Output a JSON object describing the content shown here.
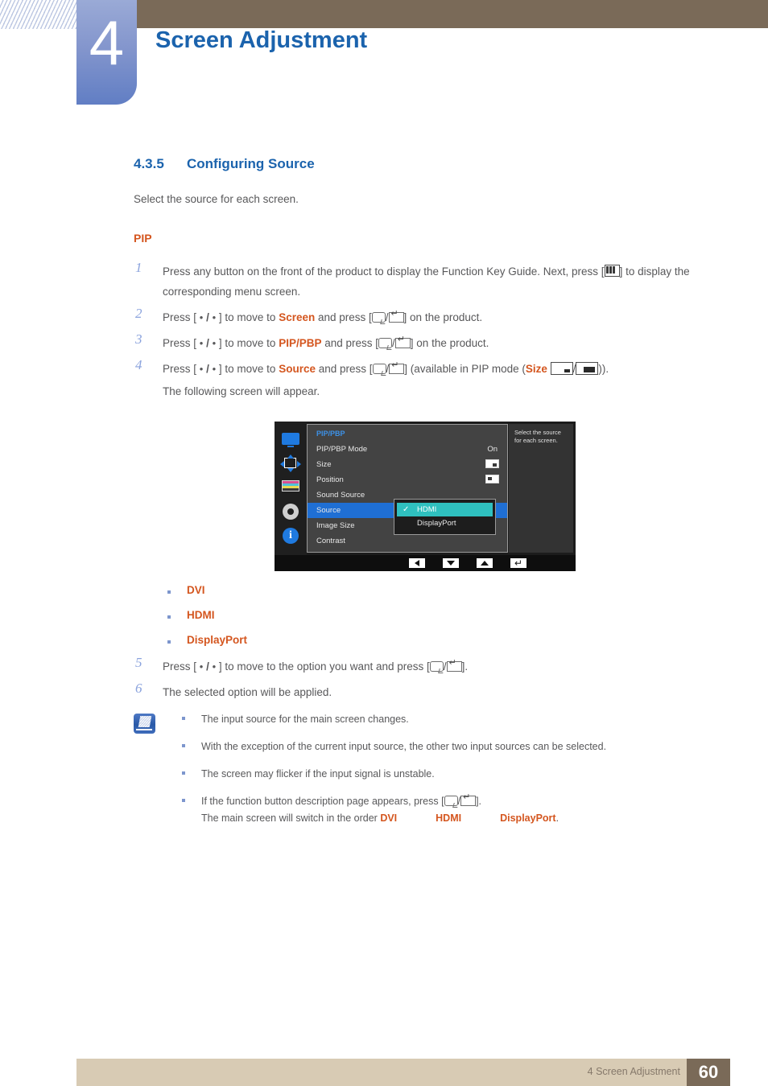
{
  "header": {
    "chapter_number": "4",
    "chapter_title": "Screen Adjustment"
  },
  "section": {
    "number": "4.3.5",
    "title": "Configuring Source",
    "intro": "Select the source for each screen.",
    "subheading": "PIP"
  },
  "steps": [
    {
      "num": "1",
      "text_before": "Press any button on the front of the product to display the Function Key Guide. Next, press [",
      "text_after": "] to display the corresponding menu screen."
    },
    {
      "num": "2",
      "p1": "Press [ ",
      "slash": " / ",
      "p2": " ] to move to ",
      "highlight": "Screen",
      "p3": " and press [",
      "p4": "] on the product."
    },
    {
      "num": "3",
      "p1": "Press [ ",
      "slash": " / ",
      "p2": " ] to move to ",
      "highlight": "PIP/PBP",
      "p3": " and press [",
      "p4": "] on the product."
    },
    {
      "num": "4",
      "p1": "Press [ ",
      "slash": " / ",
      "p2": " ] to move to ",
      "highlight": "Source",
      "p3": " and press [",
      "p4": "] (available in PIP mode (",
      "highlight2": "Size",
      "p5": "/",
      "p6": ")).",
      "sub": "The following screen will appear."
    }
  ],
  "steps2": [
    {
      "num": "5",
      "p1": "Press [ ",
      "slash": " / ",
      "p2": " ] to move to the option you want and press [",
      "p3": "]."
    },
    {
      "num": "6",
      "p1": "The selected option will be applied."
    }
  ],
  "options": [
    {
      "label": "DVI"
    },
    {
      "label": "HDMI"
    },
    {
      "label": "DisplayPort"
    }
  ],
  "osd": {
    "panel_title": "PIP/PBP",
    "rows": [
      {
        "label": "PIP/PBP Mode",
        "value": "On",
        "value_type": "text",
        "selected": false
      },
      {
        "label": "Size",
        "value": "",
        "value_type": "size-icon",
        "selected": false
      },
      {
        "label": "Position",
        "value": "",
        "value_type": "position-icon",
        "selected": false
      },
      {
        "label": "Sound Source",
        "value": "",
        "value_type": "none",
        "selected": false
      },
      {
        "label": "Source",
        "value": "",
        "value_type": "none",
        "selected": true
      },
      {
        "label": "Image Size",
        "value": "",
        "value_type": "none",
        "selected": false
      },
      {
        "label": "Contrast",
        "value": "",
        "value_type": "none",
        "selected": false
      }
    ],
    "submenu": [
      {
        "label": "HDMI",
        "checked": true
      },
      {
        "label": "DisplayPort",
        "checked": false
      }
    ],
    "help_text": "Select the source for each screen.",
    "sidebar_icons": [
      "monitor-icon",
      "pip-position-icon",
      "color-icon",
      "gear-icon",
      "info-icon"
    ],
    "buttons": [
      "left-arrow-button",
      "down-arrow-button",
      "up-arrow-button",
      "enter-button"
    ],
    "colors": {
      "selected_row": "#1f6fd4",
      "submenu_active": "#2fc0bf",
      "title": "#3d92e8"
    }
  },
  "note": {
    "items": [
      {
        "text": "The input source for the main screen changes."
      },
      {
        "text": "With the exception of the current input source, the other two input sources can be selected."
      },
      {
        "text": "The screen may flicker if the input signal is unstable."
      }
    ],
    "last_item": {
      "line1_before": "If the function button description page appears, press  [",
      "line1_after": "].",
      "line2_before": "The main screen will switch in the order ",
      "src1": "DVI",
      "src2": "HDMI",
      "src3": "DisplayPort",
      "line2_after": "."
    }
  },
  "footer": {
    "text": "4 Screen Adjustment",
    "page": "60"
  },
  "colors": {
    "accent_blue": "#1b63ad",
    "accent_orange": "#d4561f",
    "header_brown": "#7a6a58",
    "footer_tan": "#d8cbb4",
    "body_gray": "#58585a"
  }
}
